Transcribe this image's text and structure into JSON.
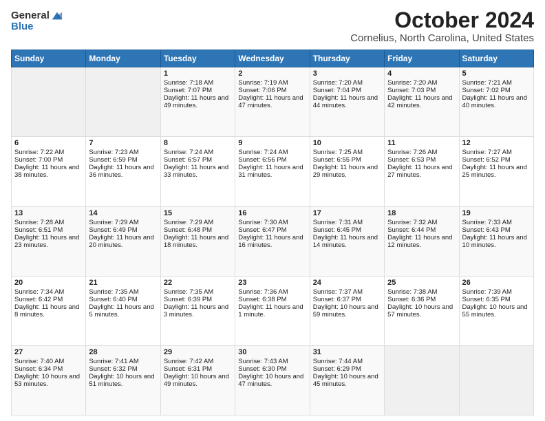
{
  "header": {
    "logo_line1": "General",
    "logo_line2": "Blue",
    "title": "October 2024",
    "subtitle": "Cornelius, North Carolina, United States"
  },
  "days_of_week": [
    "Sunday",
    "Monday",
    "Tuesday",
    "Wednesday",
    "Thursday",
    "Friday",
    "Saturday"
  ],
  "weeks": [
    [
      {
        "day": "",
        "info": ""
      },
      {
        "day": "",
        "info": ""
      },
      {
        "day": "1",
        "info": "Sunrise: 7:18 AM\nSunset: 7:07 PM\nDaylight: 11 hours and 49 minutes."
      },
      {
        "day": "2",
        "info": "Sunrise: 7:19 AM\nSunset: 7:06 PM\nDaylight: 11 hours and 47 minutes."
      },
      {
        "day": "3",
        "info": "Sunrise: 7:20 AM\nSunset: 7:04 PM\nDaylight: 11 hours and 44 minutes."
      },
      {
        "day": "4",
        "info": "Sunrise: 7:20 AM\nSunset: 7:03 PM\nDaylight: 11 hours and 42 minutes."
      },
      {
        "day": "5",
        "info": "Sunrise: 7:21 AM\nSunset: 7:02 PM\nDaylight: 11 hours and 40 minutes."
      }
    ],
    [
      {
        "day": "6",
        "info": "Sunrise: 7:22 AM\nSunset: 7:00 PM\nDaylight: 11 hours and 38 minutes."
      },
      {
        "day": "7",
        "info": "Sunrise: 7:23 AM\nSunset: 6:59 PM\nDaylight: 11 hours and 36 minutes."
      },
      {
        "day": "8",
        "info": "Sunrise: 7:24 AM\nSunset: 6:57 PM\nDaylight: 11 hours and 33 minutes."
      },
      {
        "day": "9",
        "info": "Sunrise: 7:24 AM\nSunset: 6:56 PM\nDaylight: 11 hours and 31 minutes."
      },
      {
        "day": "10",
        "info": "Sunrise: 7:25 AM\nSunset: 6:55 PM\nDaylight: 11 hours and 29 minutes."
      },
      {
        "day": "11",
        "info": "Sunrise: 7:26 AM\nSunset: 6:53 PM\nDaylight: 11 hours and 27 minutes."
      },
      {
        "day": "12",
        "info": "Sunrise: 7:27 AM\nSunset: 6:52 PM\nDaylight: 11 hours and 25 minutes."
      }
    ],
    [
      {
        "day": "13",
        "info": "Sunrise: 7:28 AM\nSunset: 6:51 PM\nDaylight: 11 hours and 23 minutes."
      },
      {
        "day": "14",
        "info": "Sunrise: 7:29 AM\nSunset: 6:49 PM\nDaylight: 11 hours and 20 minutes."
      },
      {
        "day": "15",
        "info": "Sunrise: 7:29 AM\nSunset: 6:48 PM\nDaylight: 11 hours and 18 minutes."
      },
      {
        "day": "16",
        "info": "Sunrise: 7:30 AM\nSunset: 6:47 PM\nDaylight: 11 hours and 16 minutes."
      },
      {
        "day": "17",
        "info": "Sunrise: 7:31 AM\nSunset: 6:45 PM\nDaylight: 11 hours and 14 minutes."
      },
      {
        "day": "18",
        "info": "Sunrise: 7:32 AM\nSunset: 6:44 PM\nDaylight: 11 hours and 12 minutes."
      },
      {
        "day": "19",
        "info": "Sunrise: 7:33 AM\nSunset: 6:43 PM\nDaylight: 11 hours and 10 minutes."
      }
    ],
    [
      {
        "day": "20",
        "info": "Sunrise: 7:34 AM\nSunset: 6:42 PM\nDaylight: 11 hours and 8 minutes."
      },
      {
        "day": "21",
        "info": "Sunrise: 7:35 AM\nSunset: 6:40 PM\nDaylight: 11 hours and 5 minutes."
      },
      {
        "day": "22",
        "info": "Sunrise: 7:35 AM\nSunset: 6:39 PM\nDaylight: 11 hours and 3 minutes."
      },
      {
        "day": "23",
        "info": "Sunrise: 7:36 AM\nSunset: 6:38 PM\nDaylight: 11 hours and 1 minute."
      },
      {
        "day": "24",
        "info": "Sunrise: 7:37 AM\nSunset: 6:37 PM\nDaylight: 10 hours and 59 minutes."
      },
      {
        "day": "25",
        "info": "Sunrise: 7:38 AM\nSunset: 6:36 PM\nDaylight: 10 hours and 57 minutes."
      },
      {
        "day": "26",
        "info": "Sunrise: 7:39 AM\nSunset: 6:35 PM\nDaylight: 10 hours and 55 minutes."
      }
    ],
    [
      {
        "day": "27",
        "info": "Sunrise: 7:40 AM\nSunset: 6:34 PM\nDaylight: 10 hours and 53 minutes."
      },
      {
        "day": "28",
        "info": "Sunrise: 7:41 AM\nSunset: 6:32 PM\nDaylight: 10 hours and 51 minutes."
      },
      {
        "day": "29",
        "info": "Sunrise: 7:42 AM\nSunset: 6:31 PM\nDaylight: 10 hours and 49 minutes."
      },
      {
        "day": "30",
        "info": "Sunrise: 7:43 AM\nSunset: 6:30 PM\nDaylight: 10 hours and 47 minutes."
      },
      {
        "day": "31",
        "info": "Sunrise: 7:44 AM\nSunset: 6:29 PM\nDaylight: 10 hours and 45 minutes."
      },
      {
        "day": "",
        "info": ""
      },
      {
        "day": "",
        "info": ""
      }
    ]
  ]
}
